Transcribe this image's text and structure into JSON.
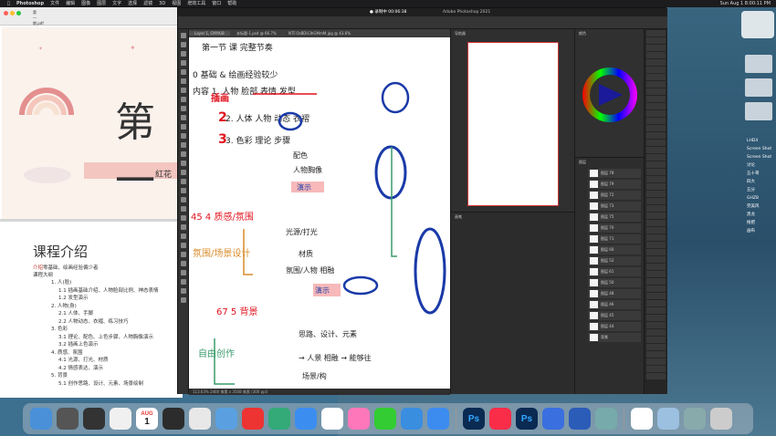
{
  "menubar": {
    "app": "Photoshop",
    "items": [
      "文件",
      "编辑",
      "图像",
      "图层",
      "文字",
      "选择",
      "滤镜",
      "3D",
      "视图",
      "增效工具",
      "窗口",
      "帮助"
    ],
    "clock": "Sun Aug 1 8:00:11 PM"
  },
  "slide_window": {
    "title": "第一期.pdf",
    "slide_title": "第一",
    "slide_subtitle": "紅花"
  },
  "course_window": {
    "heading": "课程介绍",
    "intro_label": "介绍",
    "intro_text": "零基础、绘画经验偏少者",
    "outline_label": "课程大纲",
    "lines": [
      {
        "num": "1.",
        "text": "人(脸)"
      },
      {
        "num": "1.1",
        "text": "插画基础介绍、人物脸部比例、神态表情"
      },
      {
        "num": "1.2",
        "text": "发型演示"
      },
      {
        "num": "2.",
        "text": "人物(身)"
      },
      {
        "num": "2.1",
        "text": "人体、手脚"
      },
      {
        "num": "2.2",
        "text": "人物动态、衣褶、练习技巧"
      },
      {
        "num": "3.",
        "text": "色彩"
      },
      {
        "num": "3.1",
        "text": "理论、配色、上色步骤、人物胸像演示"
      },
      {
        "num": "3.2",
        "text": "插画上色演示"
      },
      {
        "num": "4.",
        "text": "质感、氛围"
      },
      {
        "num": "4.1",
        "text": "光源、打光、材质"
      },
      {
        "num": "4.2",
        "text": "情感表达、演示"
      },
      {
        "num": "5.",
        "text": "背景"
      },
      {
        "num": "5.1",
        "text": "创作思路、设计、元素、场景绘制"
      }
    ]
  },
  "photoshop": {
    "window_title": "Adobe Photoshop 2021",
    "recording": "● 录制中 00:06:38",
    "tabs": [
      "Layer 1, CMYK/8",
      "未标题-1.psd @ 66.7%",
      "NTF.OzBDU3hGMmM.jpg @ 43.6%"
    ],
    "status": "113.63%   2480 像素 x 3508 像素 (300 ppi)",
    "zoom_label": "113.63%",
    "layers_panel_tabs": [
      "图层",
      "通道",
      "路径"
    ],
    "layer_names": [
      "图层 78",
      "图层 79",
      "图层 72",
      "图层 73",
      "图层 75",
      "图层 70",
      "图层 71",
      "图层 60",
      "图层 52",
      "图层 61",
      "图层 50",
      "图层 48",
      "图层 46",
      "图层 45",
      "图层 44",
      "背景"
    ],
    "panel_tabs": [
      "颜色",
      "色板",
      "渐变",
      "图案"
    ],
    "brush_tab": "画笔",
    "nav_tab": "导航器"
  },
  "canvas_notes": {
    "top": "第一节 课 完整节奏",
    "line1": "0 基础 & 绘画经验较少",
    "line2": "内容 1. 人物 脸部 表情 发型",
    "line3": "2. 人体 人物 动态 衣褶",
    "line4": "3. 色彩 理论 步骤",
    "c1": "配色",
    "c2": "人物胸像",
    "demo": "演示",
    "pic": "插画",
    "four": "45  4 质感/氛围",
    "ambient": "光源/打光",
    "material": "材质",
    "atmos": "氛围/人物 相融",
    "stage": "演示",
    "scene": "氛围/场景设计",
    "five": "67  5 背景",
    "ideas": "思路、设计、元素",
    "people": "→ 人景 相融 → 能够往",
    "bg": "场景/构",
    "free": "自由创作"
  },
  "colors": {
    "red": "#e1121e",
    "blue": "#1a3aa8",
    "orange": "#d98c2a",
    "green": "#3a9b6a",
    "dark": "#222"
  },
  "dock": {
    "apps": [
      "finder",
      "launchpad",
      "magnify",
      "reminders",
      "calendar-aug-1",
      "misc",
      "panda",
      "app3",
      "netease",
      "maps",
      "safari",
      "chrome",
      "photos",
      "messages",
      "mail",
      "feishu",
      "ps",
      "music",
      "ps2",
      "lightning",
      "word",
      "preview",
      "clock",
      "folder",
      "img",
      "trash"
    ],
    "calendar_month": "AUG",
    "calendar_day": "1"
  },
  "side": {
    "labels": [
      "LHD4",
      "Screen Shot",
      "Screen Shot",
      "讨论",
      "五十哥",
      "四大",
      "五分",
      "GHZ8",
      "完美风",
      "黑龙",
      "拖把",
      "画布"
    ]
  }
}
